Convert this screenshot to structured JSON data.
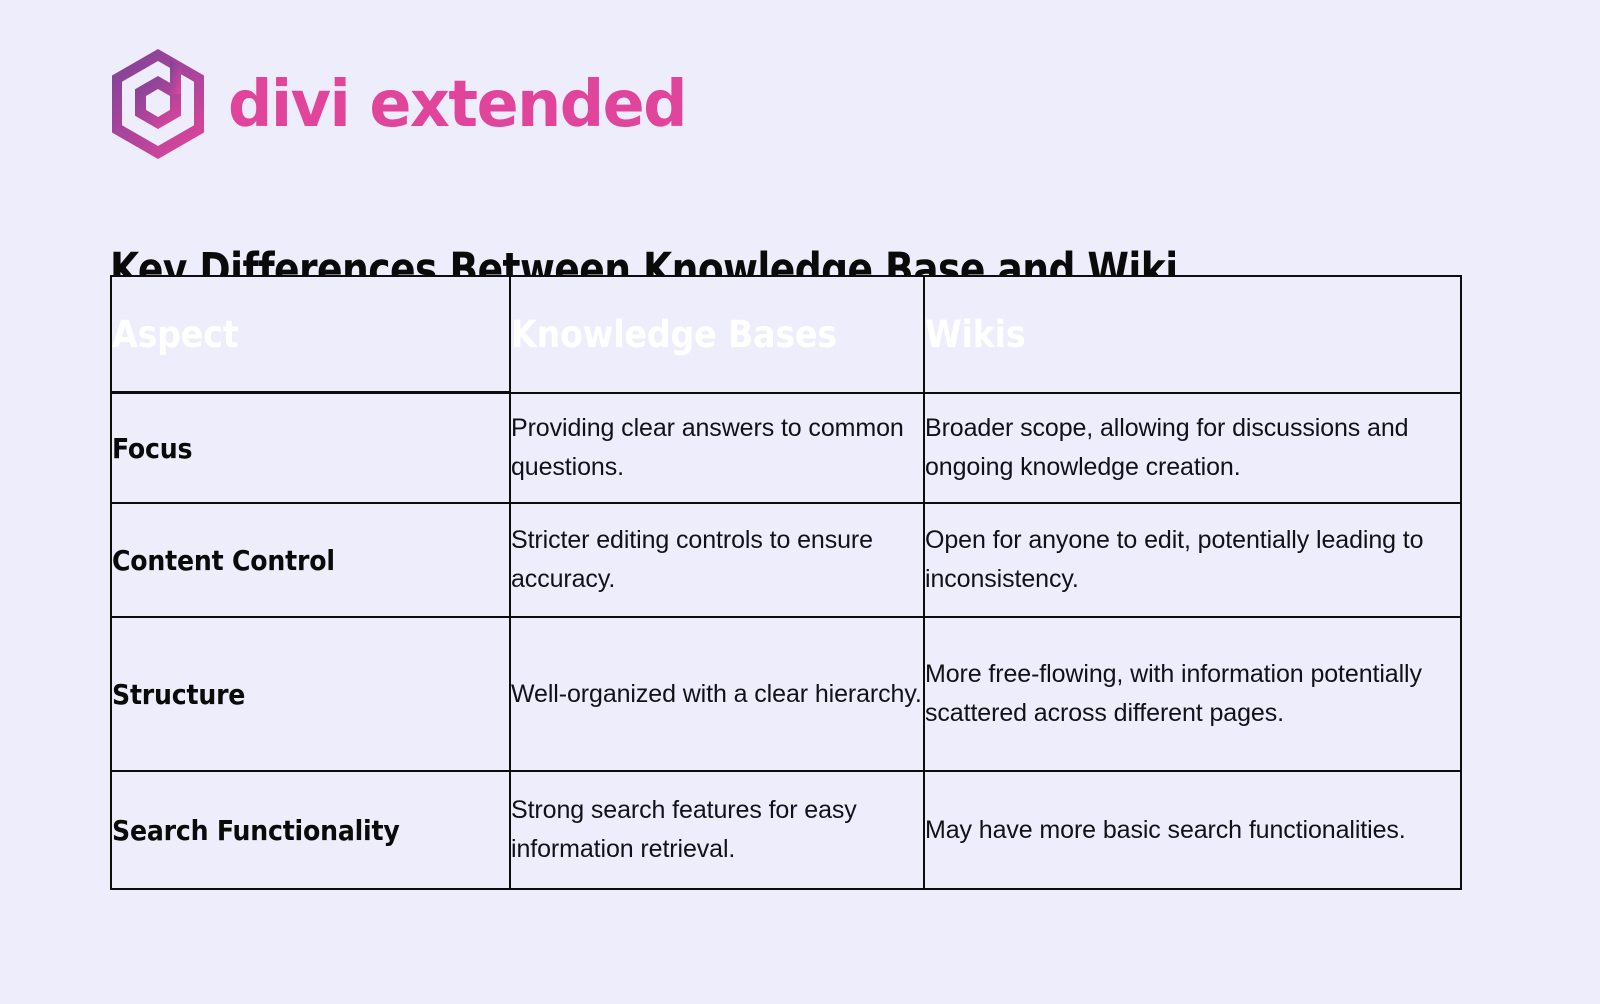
{
  "brand": {
    "logo_icon": "divi-hexagon-d-icon",
    "wordmark": "divi extended",
    "wordmark_color": "#e0459b",
    "logo_gradient_start": "#7b4397",
    "logo_gradient_end": "#d9459a"
  },
  "page": {
    "background_color": "#eeedfb",
    "title": "Key Differences Between Knowledge Base and Wiki"
  },
  "table": {
    "header_background": "#a8479c",
    "header_text_color": "#ffffff",
    "border_color": "#0d0d0d",
    "cell_background": "#eeedfb",
    "columns": [
      "Aspect",
      "Knowledge Bases",
      "Wikis"
    ],
    "rows": [
      {
        "aspect": "Focus",
        "knowledge_base": "Providing clear answers to common questions.",
        "wiki": "Broader scope, allowing for discussions and ongoing knowledge creation."
      },
      {
        "aspect": "Content Control",
        "knowledge_base": "Stricter editing controls to ensure accuracy.",
        "wiki": "Open for anyone to edit, potentially leading to inconsistency."
      },
      {
        "aspect": "Structure",
        "knowledge_base": "Well-organized with a clear hierarchy.",
        "wiki": "More free-flowing, with information potentially scattered across different pages."
      },
      {
        "aspect": "Search Functionality",
        "knowledge_base": "Strong search features for easy information retrieval.",
        "wiki": "May have more basic search functionalities."
      }
    ]
  }
}
